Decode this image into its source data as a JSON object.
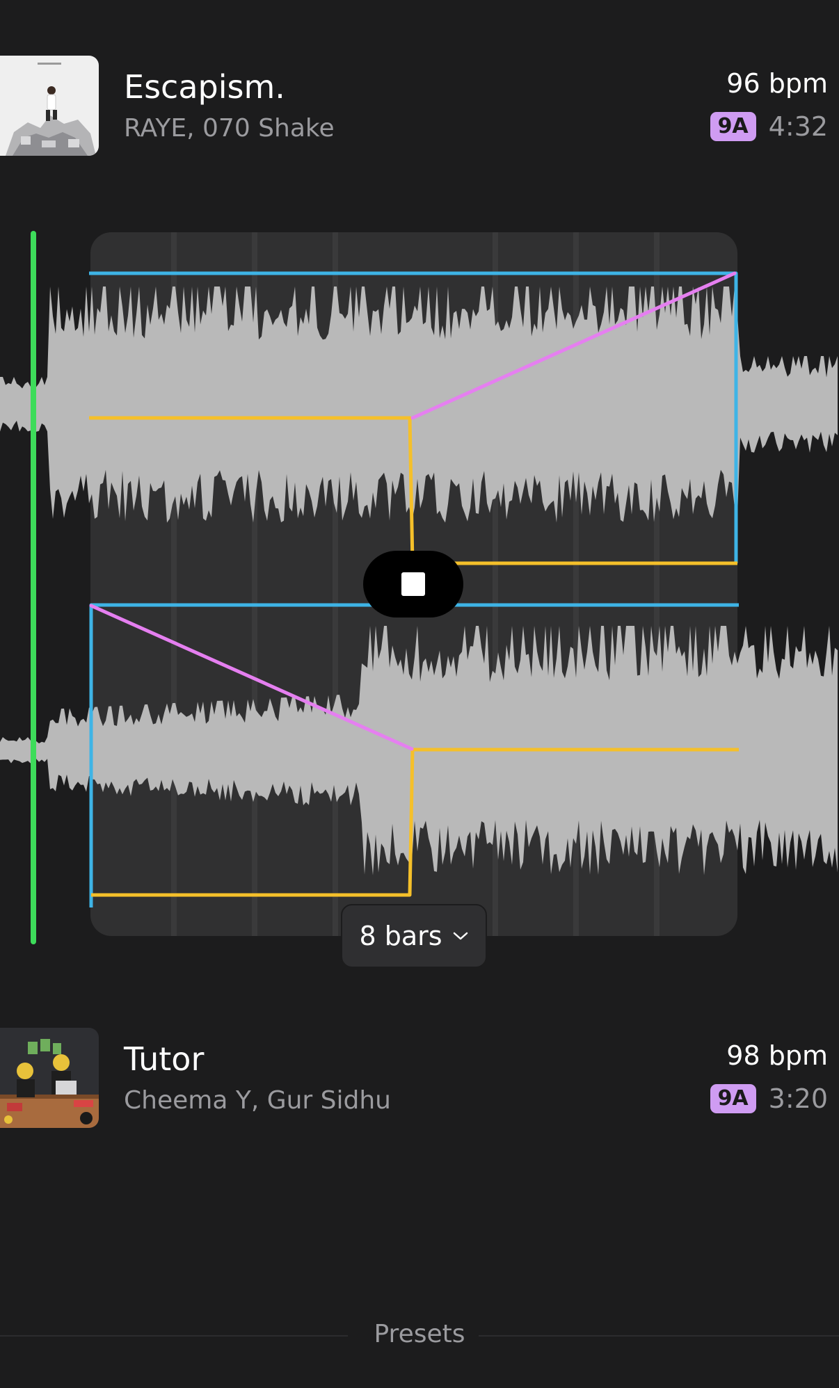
{
  "tracks": [
    {
      "title": "Escapism.",
      "artists": "RAYE, 070 Shake",
      "bpm": "96 bpm",
      "key": "9A",
      "duration": "4:32"
    },
    {
      "title": "Tutor",
      "artists": "Cheema Y, Gur Sidhu",
      "bpm": "98 bpm",
      "key": "9A",
      "duration": "3:20"
    }
  ],
  "transition": {
    "length_label": "8 bars",
    "playback_state": "playing"
  },
  "footer": {
    "presets_label": "Presets"
  },
  "colors": {
    "background": "#1c1c1d",
    "key_badge": "#cf9cf2",
    "playhead": "#3ddc5a",
    "volume_envelope": "#3eb4e6",
    "eq_envelope": "#f5c02a",
    "filter_envelope": "#e57ff0",
    "waveform": "#b9b9b9"
  }
}
